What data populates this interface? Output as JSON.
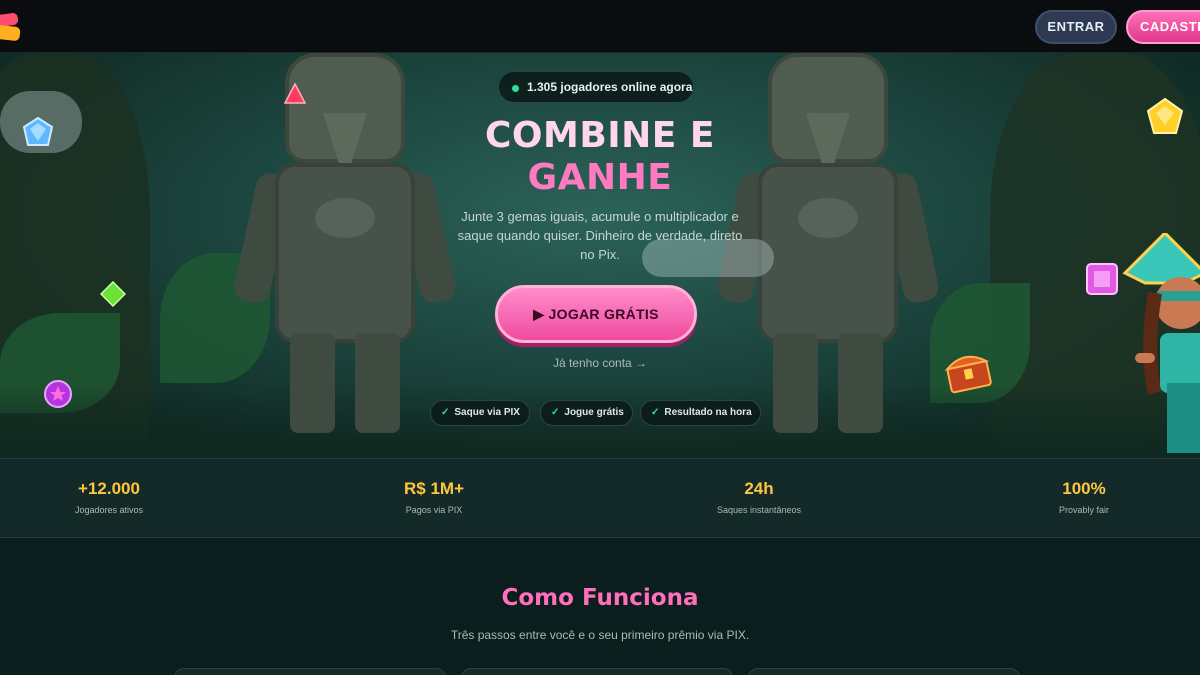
{
  "header": {
    "login_label": "ENTRAR",
    "signup_label": "CADASTR"
  },
  "hero": {
    "online_text": "1.305 jogadores online agora",
    "title_line1": "COMBINE E",
    "title_line2": "GANHE",
    "subtitle": "Junte 3 gemas iguais, acumule o multiplicador e saque quando quiser. Dinheiro de verdade, direto no Pix.",
    "cta_label": "▶ JOGAR GRÁTIS",
    "login_link": "Já tenho conta →",
    "badges": [
      {
        "check": "✓",
        "label": "Saque via PIX"
      },
      {
        "check": "✓",
        "label": "Jogue grátis"
      },
      {
        "check": "✓",
        "label": "Resultado na hora"
      }
    ]
  },
  "stats": [
    {
      "value": "+12.000",
      "label": "Jogadores ativos"
    },
    {
      "value": "R$ 1M+",
      "label": "Pagos via PIX"
    },
    {
      "value": "24h",
      "label": "Saques instantâneos"
    },
    {
      "value": "100%",
      "label": "Provably fair"
    }
  ],
  "how": {
    "title": "Como Funciona",
    "subtitle": "Três passos entre você e o seu primeiro prêmio via PIX."
  },
  "colors": {
    "accent_pink": "#ff6fbb",
    "stat_gold": "#ffc73d",
    "online_green": "#2ee09a"
  }
}
